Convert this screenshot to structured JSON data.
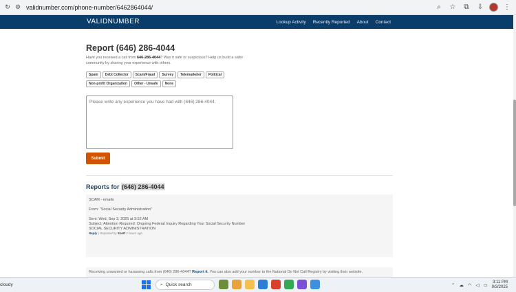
{
  "browser": {
    "url": "validnumber.com/phone-number/6462864044/"
  },
  "site": {
    "logo": "VALIDNUMBER",
    "nav": [
      "Lookup Activity",
      "Recently Reported",
      "About",
      "Contact"
    ]
  },
  "report": {
    "title": "Report (646) 286-4044",
    "intro_prefix": "Have you received a call from ",
    "intro_number": "646-286-4044",
    "intro_suffix": "? Was it safe or suspicious? Help us build a safer community by sharing your experience with others.",
    "tags": [
      "Spam",
      "Debt Collector",
      "Scam/Fraud",
      "Survey",
      "Telemarketer",
      "Political",
      "Non-profit Organization",
      "Other - Unsafe",
      "None"
    ],
    "placeholder": "Please write any experience you have had with (646) 286-4044.",
    "submit_label": "Submit"
  },
  "reports": {
    "title_prefix": "Reports for ",
    "title_number": "(646) 286-4044",
    "entry": {
      "lines": [
        "SCAM - emails",
        "",
        "From: \"Social Security Administration\"",
        "",
        "Sent: Wed, Sep 3, 2025 at 3:52 AM",
        "Subject: Attention Required: Ongoing Federal Inquiry Regarding Your Social Security Number",
        "SOCIAL SECURITY ADMINISTRATION"
      ],
      "reply_label": "Reply",
      "reported_by_prefix": "Reported by",
      "author": "Scott",
      "time": "2 hours ago"
    },
    "note_prefix": "Receiving unwanted or harassing calls from (646) 286-4044? ",
    "note_link": "Report it",
    "note_suffix": ". You can also add your number to the National Do Not Call Registry by visiting their website."
  },
  "taskbar": {
    "weather": "cloudy",
    "search": "Quick search",
    "time": "3:11 PM",
    "date": "9/3/2025"
  }
}
